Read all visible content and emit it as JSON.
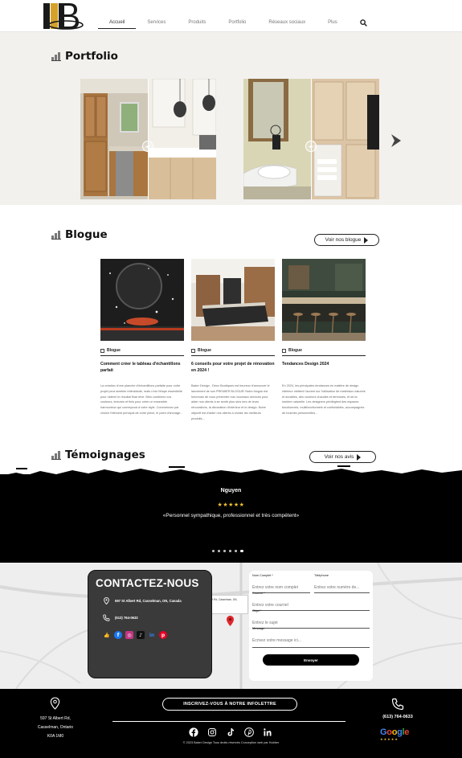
{
  "nav": {
    "items": [
      "Accueil",
      "Services",
      "Produits",
      "Portfolio",
      "Réseaux sociaux",
      "Plus"
    ],
    "active_index": 0,
    "logo_alt": "Baker Design logo"
  },
  "portfolio": {
    "title": "Portfolio"
  },
  "blog": {
    "title": "Blogue",
    "cta": "Voir nos blogue",
    "posts": [
      {
        "category": "Blogue",
        "title": "Comment créer le tableau d'échantillons parfait",
        "excerpt": "La création d'une planche d'échantillons parfaite pour votre projet peut sembler intimidante, mais c'est l'étape essentielle pour obtenir le résultat final rêvé. Bien combinez vos couleurs, textures et finis pour créer un ensemble harmonieux qui correspond à votre style. Commencez par choisir l'élément principal de votre pièce, le point d'ancrage..."
      },
      {
        "category": "Blogue",
        "title": "6 conseils pour votre projet de rénovation en 2024 !",
        "excerpt": "Baker Design - Deux Boutiques est heureux d'annoncer le lancement de son PREMIER BLOGUE! Notre blogue est heureuse de vous présenter nos nouveaux services pour aider nos clients à se sentir plus sûrs lors de leurs rénovations, la décoration d'intérieur et le design. Notre objectif est d'aider nos clients à choisir les meilleurs produits..."
      },
      {
        "category": "Blogue",
        "title": "Tendances Design 2024",
        "excerpt": "En 2024, les principales tendances en matière de design intérieur mettent l'accent sur l'utilisation de matériaux naturels et durables, des couleurs chaudes et terreuses, et de la lumière naturelle. Les designers privilégient des espaces fonctionnels, multifonctionnels et confortables, accompagnés de touches personnelles..."
      }
    ]
  },
  "testimonials": {
    "title": "Témoignages",
    "cta": "Voir nos avis",
    "name": "Nguyen",
    "stars": "★★★★★",
    "quote": "«Personnel sympathique, professionnel et très compétent»",
    "dot_count": 6,
    "active_dot": 4
  },
  "contact": {
    "title": "CONTACTEZ-NOUS",
    "address": "597 St Albert Rd, Casselman, ON, Canada",
    "phone": "(613) 764-0633",
    "map_card": "597 St Albert Rd, Casselman, ON, Canada",
    "form": {
      "name_label": "Nom Complet *",
      "name_placeholder": "Entrez votre nom complet",
      "phone_label": "Téléphone",
      "phone_placeholder": "Entrez votre numéro de...",
      "email_label": "Courriel *",
      "email_placeholder": "Entrez votre courriel",
      "subject_label": "Objet *",
      "subject_placeholder": "Entrez le sujet",
      "message_label": "Message",
      "message_placeholder": "Écrivez votre message ici...",
      "submit": "Envoyer"
    }
  },
  "footer": {
    "address_lines": [
      "597 St Albert Rd,",
      "Casselman, Ontario",
      "K0A 1M0"
    ],
    "newsletter": "INSCRIVEZ-VOUS À NOTRE INFOLETTRE",
    "phone": "(613) 764-0633",
    "copyright": "© 2023 Baker Design Tous droits réservés Conception web par Hubber",
    "google": "Google"
  },
  "colors": {
    "accent_gold": "#d4a12a",
    "star_gold": "#f2c230",
    "dark": "#000000"
  }
}
